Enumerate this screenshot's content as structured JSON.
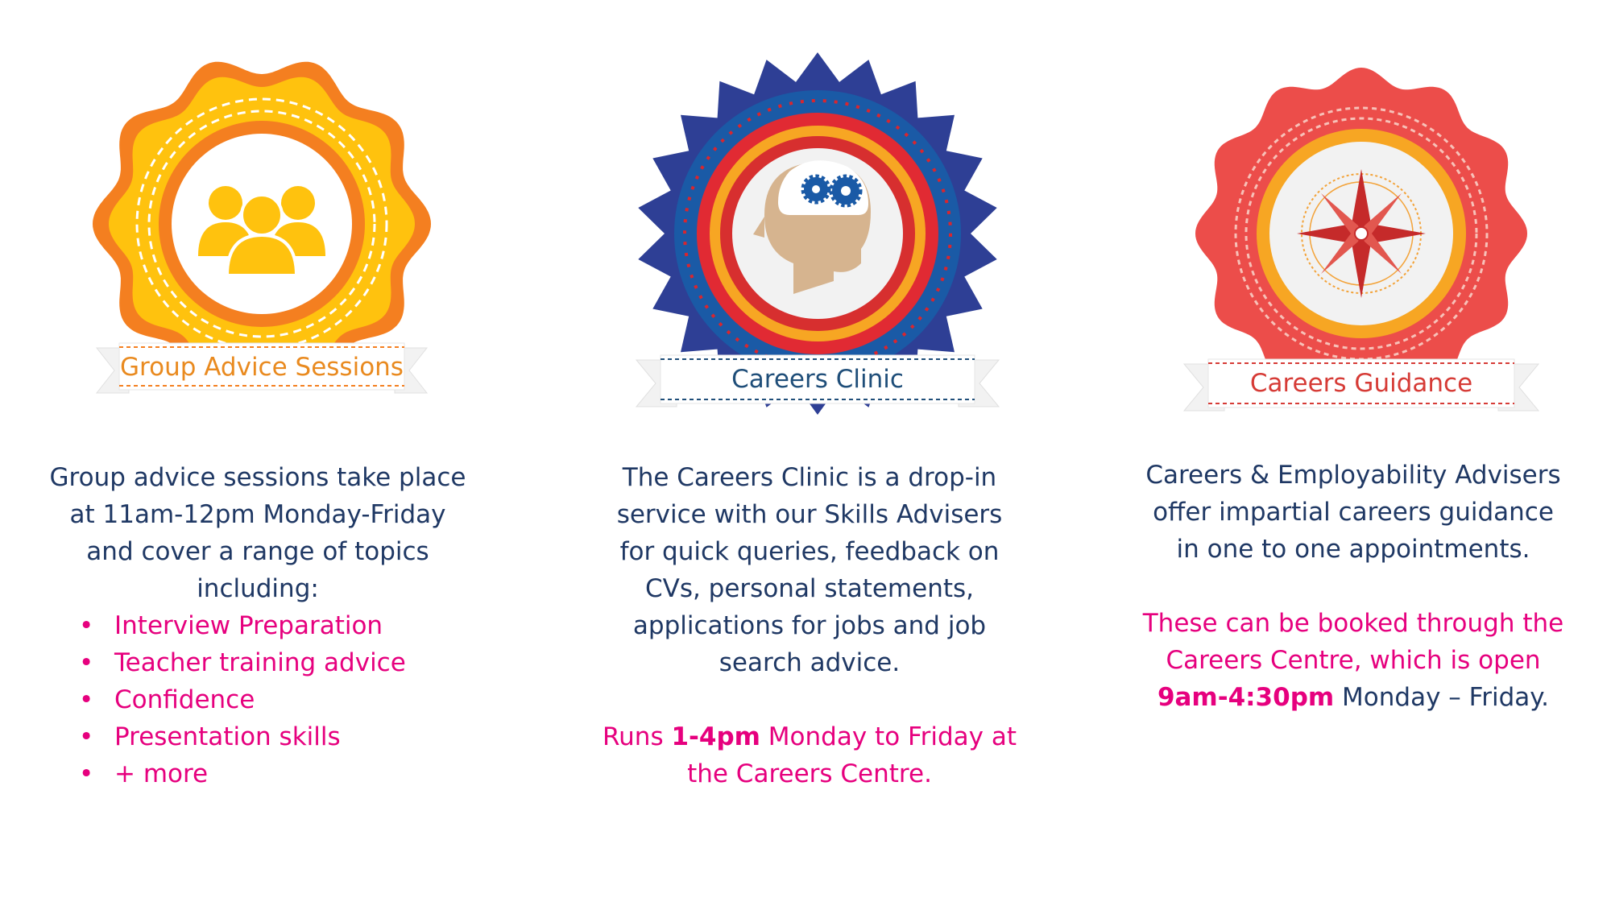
{
  "cards": [
    {
      "title": "Group Advice Sessions",
      "icon": "group-people-icon",
      "colors": {
        "outer": "#f47f20",
        "mid": "#ffc20e",
        "title": "#e98a1f"
      },
      "intro": [
        "Group advice sessions take place",
        "at 11am-12pm Monday-Friday",
        "and cover a range of topics",
        "including:"
      ],
      "topics": [
        "Interview Preparation",
        "Teacher training advice",
        "Confidence",
        "Presentation skills",
        "+ more"
      ]
    },
    {
      "title": "Careers Clinic",
      "icon": "head-gears-icon",
      "colors": {
        "outer": "#2e3f95",
        "mid": "#1a5aa6",
        "title": "#1f4e79"
      },
      "intro": [
        "The Careers Clinic is a drop-in",
        "service with our Skills Advisers",
        "for quick queries, feedback on",
        "CVs, personal statements,",
        "applications for jobs and job",
        "search advice."
      ],
      "hours": {
        "prefix": "Runs ",
        "time": "1-4pm",
        "suffix": " Monday to Friday at",
        "line2": "the Careers Centre."
      }
    },
    {
      "title": "Careers Guidance",
      "icon": "compass-rose-icon",
      "colors": {
        "outer": "#ec4d4a",
        "mid": "#f7a623",
        "title": "#d63b36"
      },
      "intro": [
        "Careers & Employability Advisers",
        "offer impartial careers guidance",
        "in one to one appointments."
      ],
      "booking": {
        "line1": "These can be booked through the",
        "line2": "Careers Centre, which is open",
        "time": "9am-4:30pm",
        "suffix": " Monday – Friday."
      }
    }
  ]
}
